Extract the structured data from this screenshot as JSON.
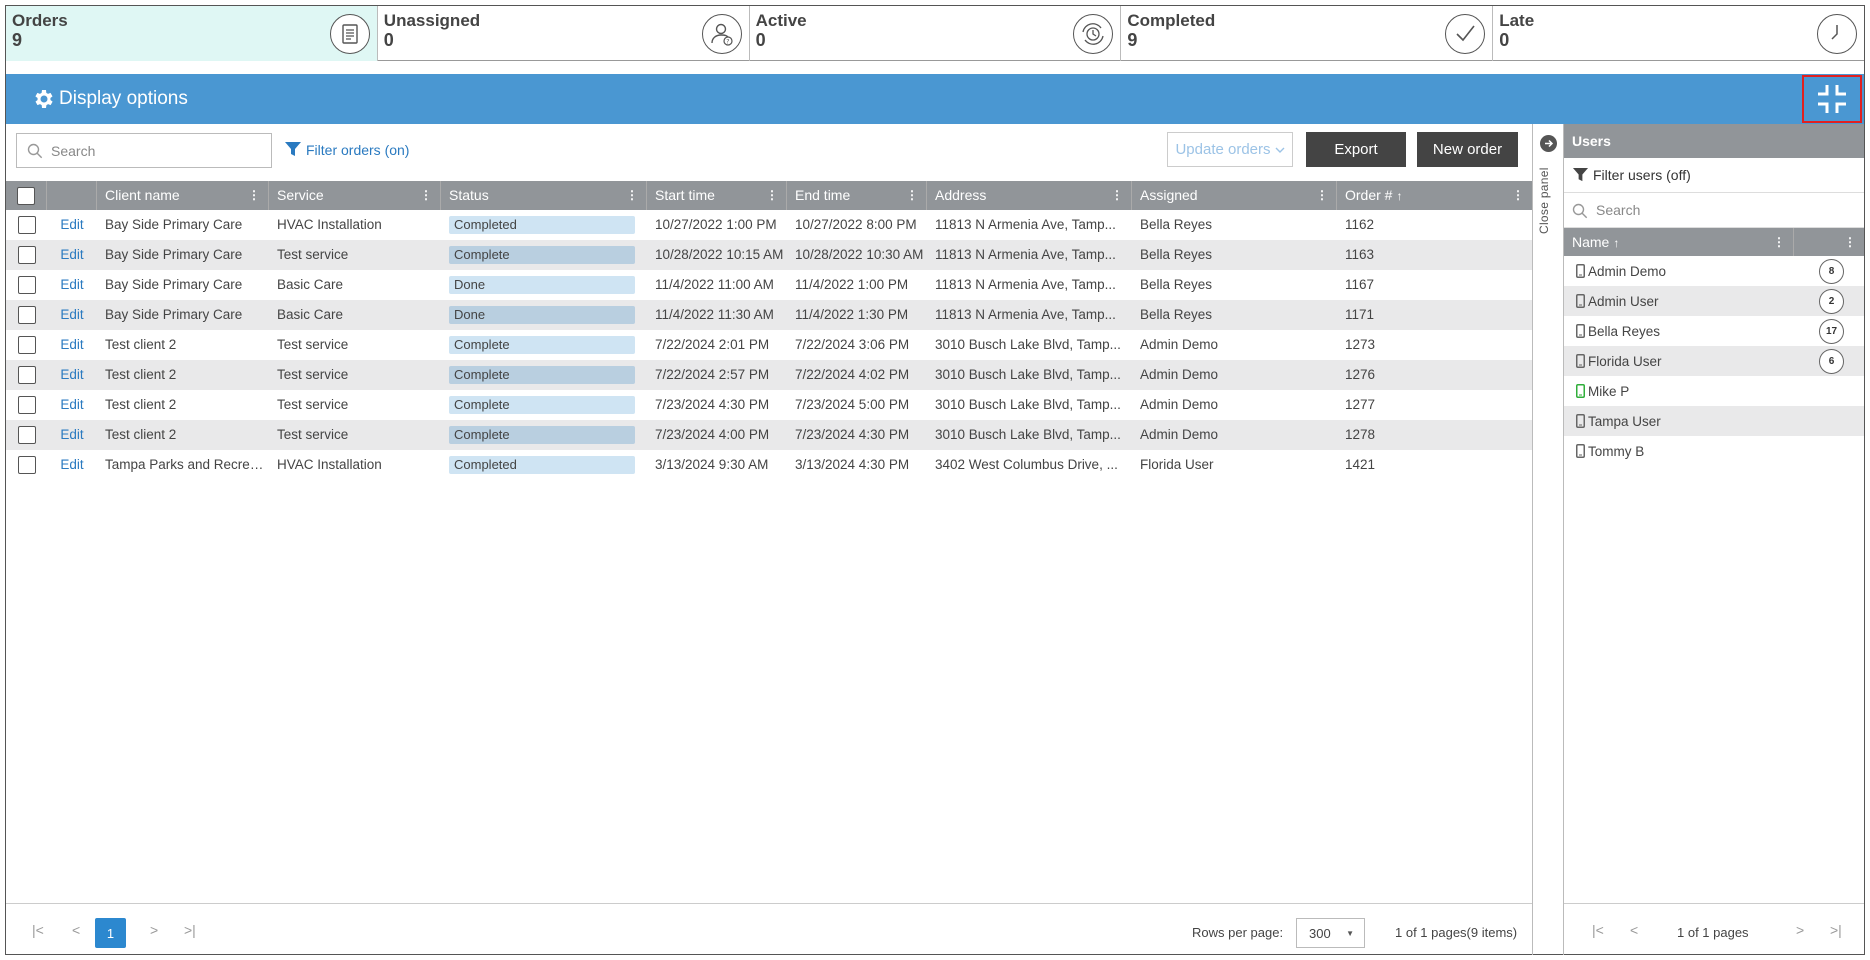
{
  "stats": [
    {
      "label": "Orders",
      "value": "9",
      "icon": "document-icon"
    },
    {
      "label": "Unassigned",
      "value": "0",
      "icon": "user-question-icon"
    },
    {
      "label": "Active",
      "value": "0",
      "icon": "clock-refresh-icon"
    },
    {
      "label": "Completed",
      "value": "9",
      "icon": "check-circle-icon"
    },
    {
      "label": "Late",
      "value": "0",
      "icon": "clock-icon"
    }
  ],
  "options_bar": {
    "label": "Display options",
    "bg_color": "#4a97d2"
  },
  "toolbar": {
    "search_placeholder": "Search",
    "filter_label": "Filter orders (on)",
    "update_label": "Update orders",
    "export_label": "Export",
    "new_order_label": "New order"
  },
  "columns": [
    "Client name",
    "Service",
    "Status",
    "Start time",
    "End time",
    "Address",
    "Assigned",
    "Order #"
  ],
  "rows": [
    {
      "edit": "Edit",
      "client": "Bay Side Primary Care",
      "service": "HVAC Installation",
      "status": "Completed",
      "start": "10/27/2022 1:00 PM",
      "end": "10/27/2022 8:00 PM",
      "address": "11813 N Armenia Ave, Tamp...",
      "assigned": "Bella Reyes",
      "order": "1162"
    },
    {
      "edit": "Edit",
      "client": "Bay Side Primary Care",
      "service": "Test service",
      "status": "Complete",
      "start": "10/28/2022 10:15 AM",
      "end": "10/28/2022 10:30 AM",
      "address": "11813 N Armenia Ave, Tamp...",
      "assigned": "Bella Reyes",
      "order": "1163"
    },
    {
      "edit": "Edit",
      "client": "Bay Side Primary Care",
      "service": "Basic Care",
      "status": "Done",
      "start": "11/4/2022 11:00 AM",
      "end": "11/4/2022 1:00 PM",
      "address": "11813 N Armenia Ave, Tamp...",
      "assigned": "Bella Reyes",
      "order": "1167"
    },
    {
      "edit": "Edit",
      "client": "Bay Side Primary Care",
      "service": "Basic Care",
      "status": "Done",
      "start": "11/4/2022 11:30 AM",
      "end": "11/4/2022 1:30 PM",
      "address": "11813 N Armenia Ave, Tamp...",
      "assigned": "Bella Reyes",
      "order": "1171"
    },
    {
      "edit": "Edit",
      "client": "Test client 2",
      "service": "Test service",
      "status": "Complete",
      "start": "7/22/2024 2:01 PM",
      "end": "7/22/2024 3:06 PM",
      "address": "3010 Busch Lake Blvd, Tamp...",
      "assigned": "Admin Demo",
      "order": "1273"
    },
    {
      "edit": "Edit",
      "client": "Test client 2",
      "service": "Test service",
      "status": "Complete",
      "start": "7/22/2024 2:57 PM",
      "end": "7/22/2024 4:02 PM",
      "address": "3010 Busch Lake Blvd, Tamp...",
      "assigned": "Admin Demo",
      "order": "1276"
    },
    {
      "edit": "Edit",
      "client": "Test client 2",
      "service": "Test service",
      "status": "Complete",
      "start": "7/23/2024 4:30 PM",
      "end": "7/23/2024 5:00 PM",
      "address": "3010 Busch Lake Blvd, Tamp...",
      "assigned": "Admin Demo",
      "order": "1277"
    },
    {
      "edit": "Edit",
      "client": "Test client 2",
      "service": "Test service",
      "status": "Complete",
      "start": "7/23/2024 4:00 PM",
      "end": "7/23/2024 4:30 PM",
      "address": "3010 Busch Lake Blvd, Tamp...",
      "assigned": "Admin Demo",
      "order": "1278"
    },
    {
      "edit": "Edit",
      "client": "Tampa Parks and Recreation",
      "service": "HVAC Installation",
      "status": "Completed",
      "start": "3/13/2024 9:30 AM",
      "end": "3/13/2024 4:30 PM",
      "address": "3402 West Columbus Drive, ...",
      "assigned": "Florida User",
      "order": "1421"
    }
  ],
  "pager": {
    "current_page": "1",
    "rows_per_page_label": "Rows per page:",
    "rows_per_page": "300",
    "pages_info": "1 of 1 pages(9 items)"
  },
  "close_panel": {
    "label": "Close panel"
  },
  "users": {
    "title": "Users",
    "filter_label": "Filter users (off)",
    "search_placeholder": "Search",
    "name_header": "Name",
    "list": [
      {
        "name": "Admin Demo",
        "count": "8",
        "phone_color": "#666666"
      },
      {
        "name": "Admin User",
        "count": "2",
        "phone_color": "#666666"
      },
      {
        "name": "Bella Reyes",
        "count": "17",
        "phone_color": "#666666"
      },
      {
        "name": "Florida User",
        "count": "6",
        "phone_color": "#666666"
      },
      {
        "name": "Mike P",
        "count": "",
        "phone_color": "#2fae3a"
      },
      {
        "name": "Tampa User",
        "count": "",
        "phone_color": "#666666"
      },
      {
        "name": "Tommy B",
        "count": "",
        "phone_color": "#666666"
      }
    ],
    "pages_info": "1 of 1 pages"
  }
}
